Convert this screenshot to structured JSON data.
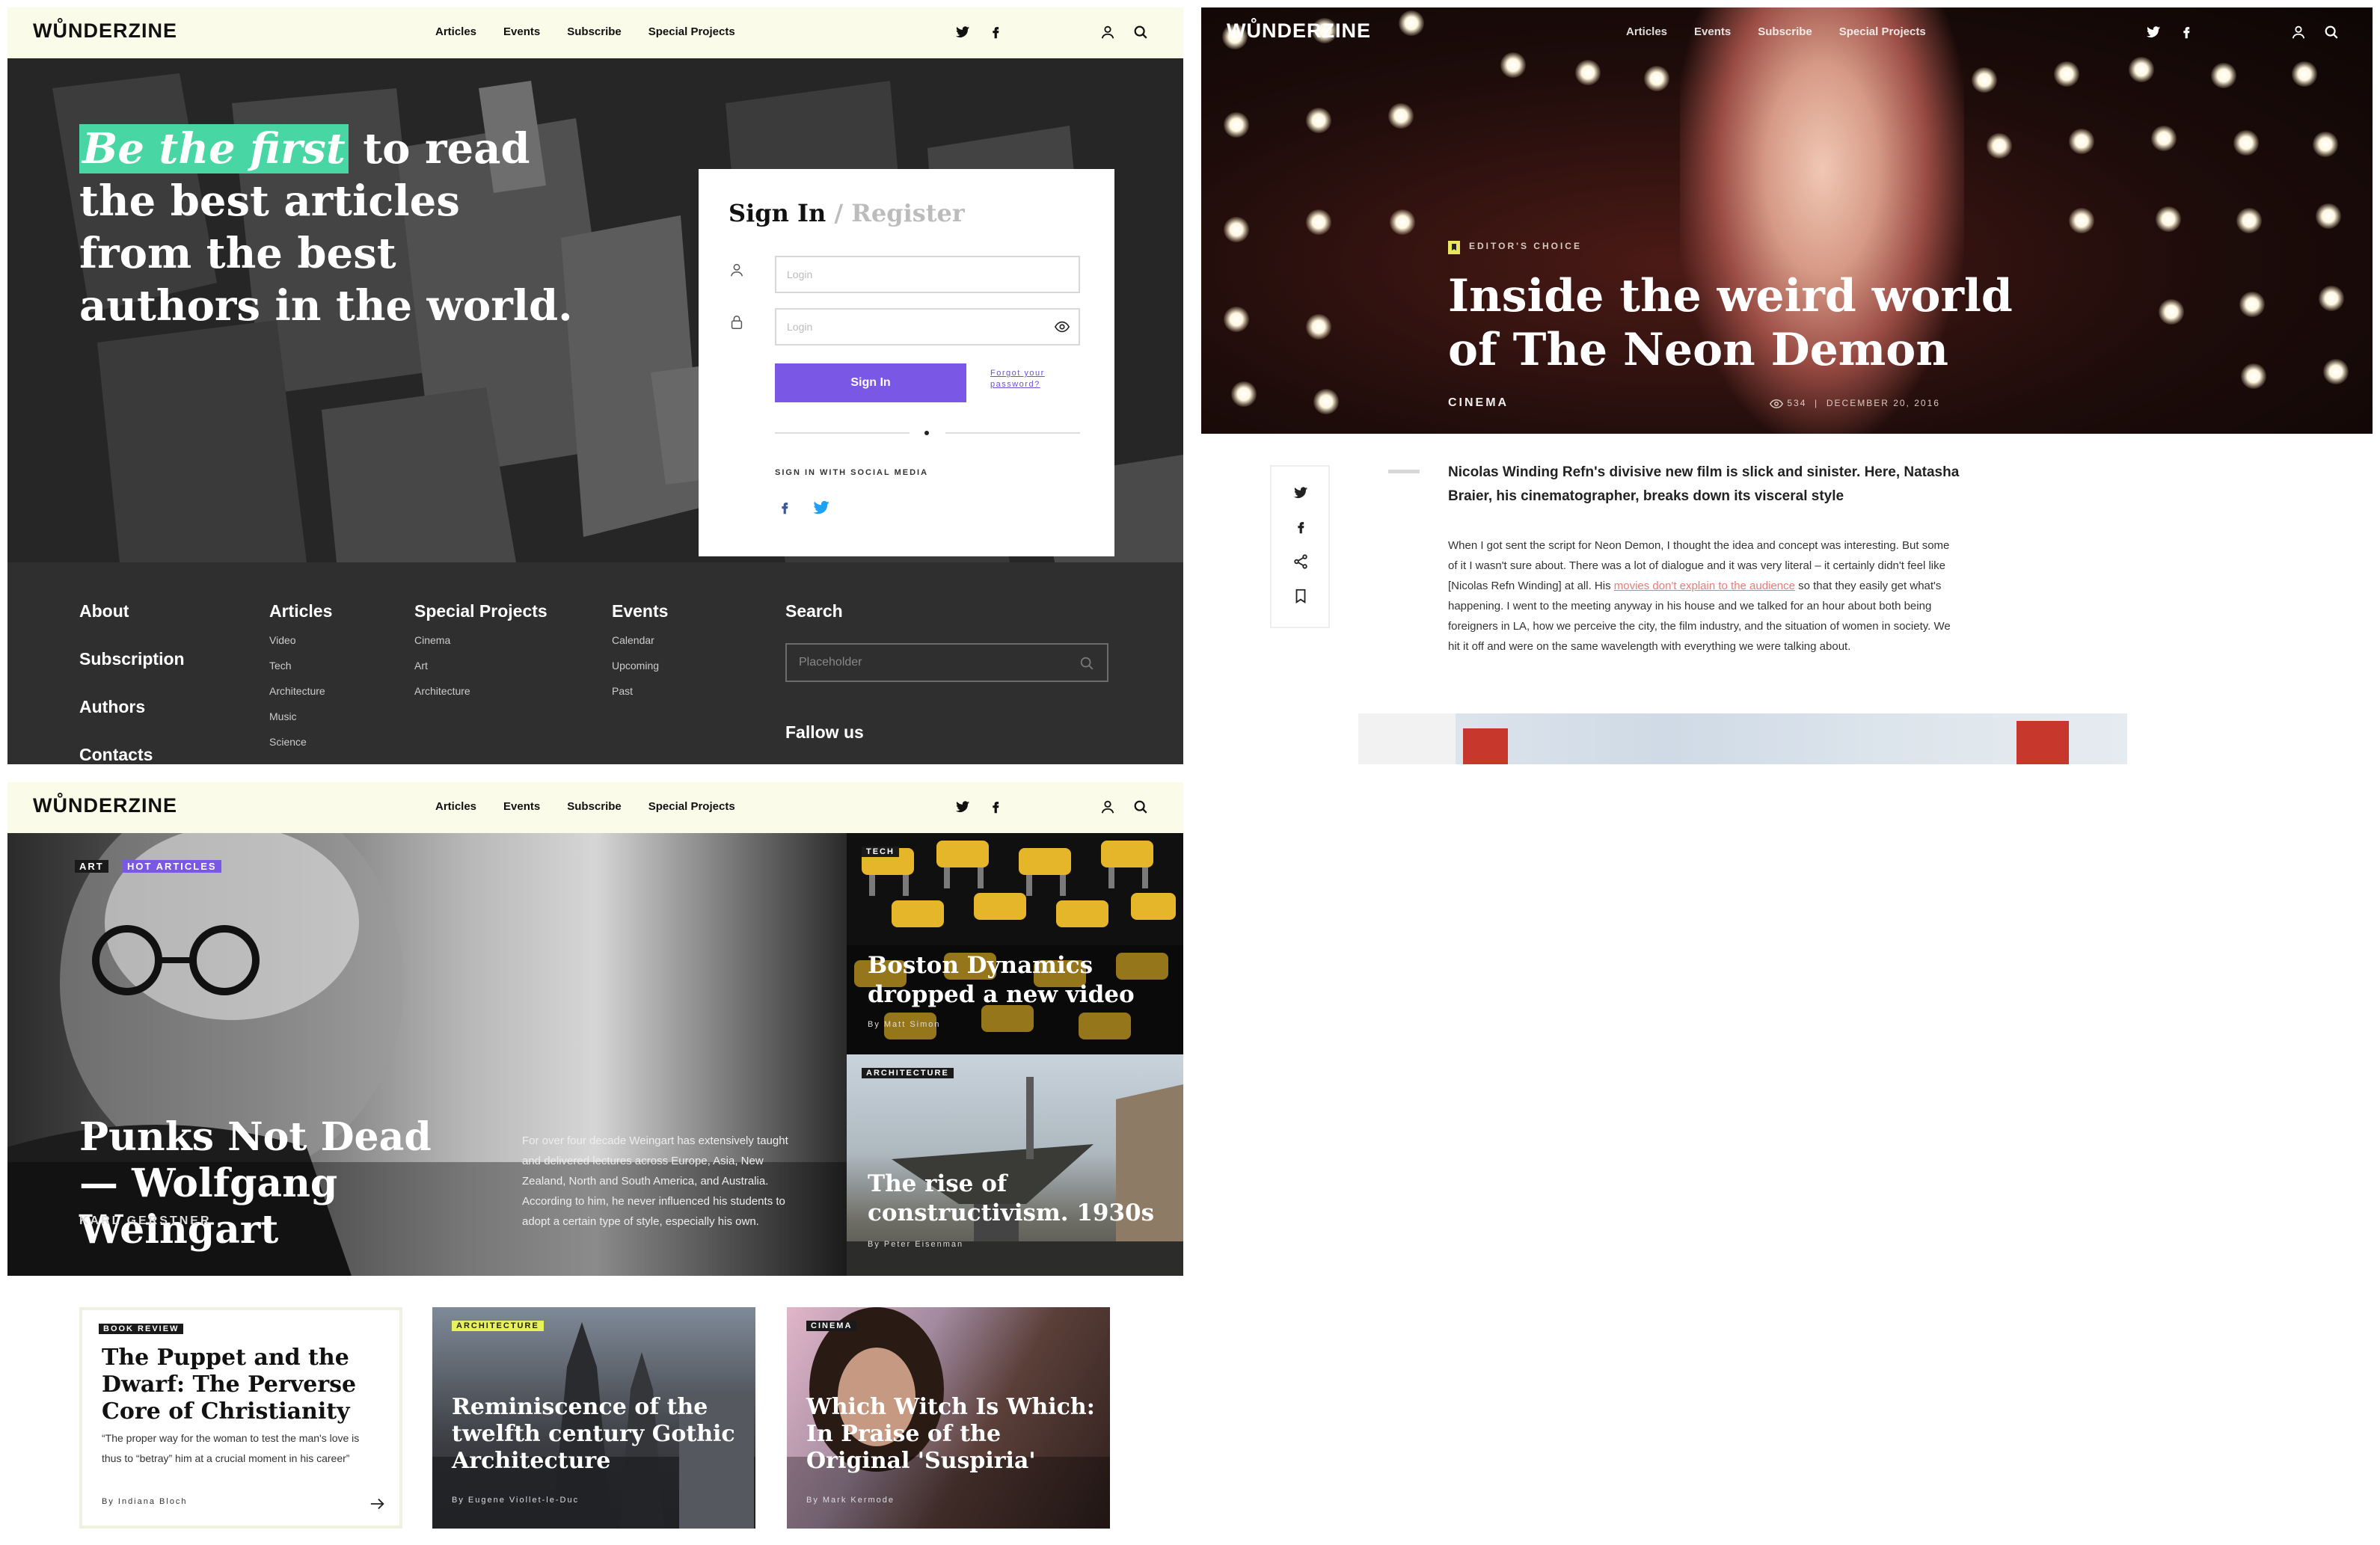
{
  "brand": {
    "logo": "WŮNDERZINE"
  },
  "nav": {
    "articles": "Articles",
    "events": "Events",
    "subscribe": "Subscribe",
    "special_projects": "Special Projects"
  },
  "signin_page": {
    "hero": {
      "highlight": "Be the first",
      "rest": " to read the best articles from the best authors in the world."
    },
    "form": {
      "title": "Sign In",
      "register": " / Register",
      "login_placeholder": "Login",
      "password_placeholder": "Login",
      "submit": "Sign In",
      "forgot": "Forgot your password?",
      "social_title": "SIGN IN WITH SOCIAL MEDIA"
    },
    "footer": {
      "about": "About",
      "subscription": "Subscription",
      "authors": "Authors",
      "contacts": "Contacts",
      "articles_title": "Articles",
      "articles_items": [
        "Video",
        "Tech",
        "Architecture",
        "Music",
        "Science"
      ],
      "special_title": "Special Projects",
      "special_items": [
        "Cinema",
        "Art",
        "Architecture"
      ],
      "events_title": "Events",
      "events_items": [
        "Calendar",
        "Upcoming",
        "Past"
      ],
      "search_title": "Search",
      "search_placeholder": "Placeholder",
      "follow": "Fallow us"
    }
  },
  "article_page": {
    "editors_choice": "EDITOR'S CHOICE",
    "title": "Inside the weird world of The Neon Demon",
    "category": "CINEMA",
    "views": "534",
    "date": "DECEMBER 20, 2016",
    "lede": "Nicolas Winding Refn's divisive new film is slick and sinister. Here, Natasha Braier, his cinematographer, breaks down its visceral style",
    "body_before": "When I got sent the script for Neon Demon, I thought the idea and concept was interesting. But some of it I wasn't sure about. There was a lot of dialogue and it was very literal – it certainly didn't feel like [Nicolas Refn Winding] at all. His ",
    "body_link": "movies don't explain to the audience",
    "body_after": " so that they easily get what's happening. I went to the meeting anyway in his house and we talked for an hour about both being foreigners in LA, how we perceive the city, the film industry, and the situation of women in society. We hit it off and were on the same wavelength with everything we were talking about."
  },
  "home_page": {
    "main": {
      "tag1": "ART",
      "tag2": "HOT ARTICLES",
      "title": "Punks Not Dead — Wolfgang Weingart",
      "author": "KARL GERSTNER",
      "description": "For over four decade Weingart has extensively taught and delivered lectures across Europe, Asia, New Zealand, North and South America, and Australia. According to him, he never influenced his students to adopt a certain type of style, especially his own."
    },
    "side": [
      {
        "tag": "TECH",
        "title": "Boston Dynamics dropped a new video",
        "author": "By Matt Simon"
      },
      {
        "tag": "ARCHITECTURE",
        "title": "The rise of constructivism. 1930s",
        "author": "By Peter Eisenman"
      }
    ],
    "cards": [
      {
        "tag": "BOOK REVIEW",
        "title": "The Puppet and the Dwarf: The Perverse Core of Christianity",
        "quote": "“The proper way for the woman to test the man's love is thus to “betray” him at a crucial moment in his career”",
        "author": "By Indiana Bloch"
      },
      {
        "tag": "ARCHITECTURE",
        "title": "Reminiscence of the twelfth century Gothic Architecture",
        "author": "By Eugene Viollet-le-Duc"
      },
      {
        "tag": "CINEMA",
        "title": "Which Witch Is Which: In Praise of the Original 'Suspiria'",
        "author": "By Mark Kermode"
      }
    ]
  }
}
